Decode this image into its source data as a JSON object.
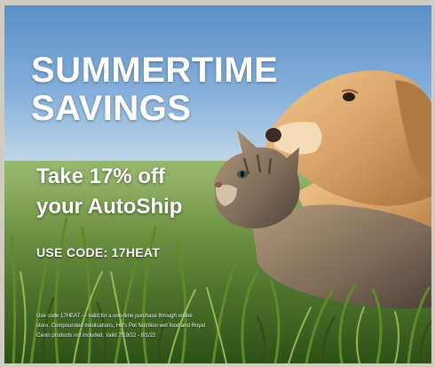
{
  "banner": {
    "headline_line1": "SUMMERTIME",
    "headline_line2": "SAVINGS",
    "offer_line1": "Take 17% off",
    "offer_line2": "your AutoShip",
    "code_text": "USE CODE: 17HEAT",
    "fine_print": "Use code 17HEAT — valid for a one-time purchase through online store. Compounded medications, Hill's Pet Nutrition wet food and Royal Canin products not included. Valid 7/19/22 - 8/1/22"
  },
  "colors": {
    "text": "#ffffff",
    "sky": "#86b1dc",
    "grass": "#3f6a22",
    "dog_fur": "#d9a367",
    "cat_fur": "#7d6a57"
  }
}
